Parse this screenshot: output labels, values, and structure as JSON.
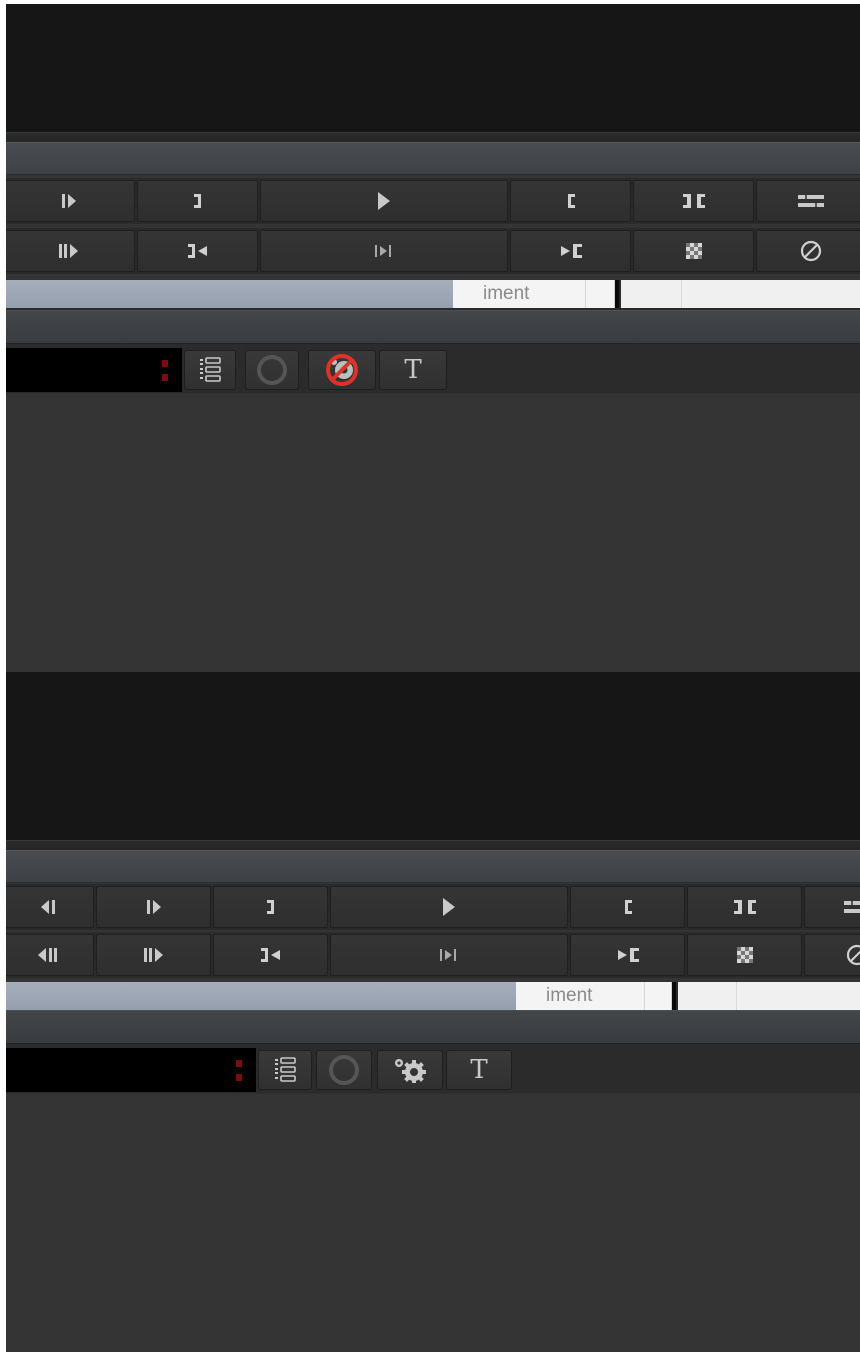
{
  "panels": [
    {
      "transport_row1": [
        "play-forward-frame-icon",
        "mark-out-bracket-icon",
        "play-icon",
        "mark-in-bracket-icon",
        "match-frame-icon",
        "timeline-tracks-icon"
      ],
      "transport_row2": [
        "play-forward-slow-icon",
        "go-to-out-icon",
        "step-to-end-icon",
        "go-to-in-icon",
        "checker-icon",
        "disable-icon"
      ],
      "scrub_label": "iment",
      "tools": [
        "list-icon",
        "record-circle-icon",
        "effects-disabled-icon",
        "text-tool-icon"
      ],
      "text_tool_label": "T"
    },
    {
      "transport_row1": [
        "step-back-frame-icon",
        "play-forward-frame-icon",
        "mark-out-bracket-icon",
        "play-icon",
        "mark-in-bracket-icon",
        "match-frame-icon",
        "timeline-tracks-icon"
      ],
      "transport_row2": [
        "play-reverse-slow-icon",
        "play-forward-slow-icon",
        "go-to-out-icon",
        "step-to-end-icon",
        "go-to-in-icon",
        "checker-icon",
        "disable-icon"
      ],
      "scrub_label": "iment",
      "tools": [
        "list-icon",
        "record-circle-icon",
        "effects-settings-icon",
        "text-tool-icon"
      ],
      "text_tool_label": "T"
    }
  ],
  "colors": {
    "viewer_bg": "#161616",
    "panel_bg": "#343434",
    "timecode_dot": "#7a0e0e",
    "disabled_red": "#e0302a",
    "scrub_fill": "#9ea8b6"
  }
}
